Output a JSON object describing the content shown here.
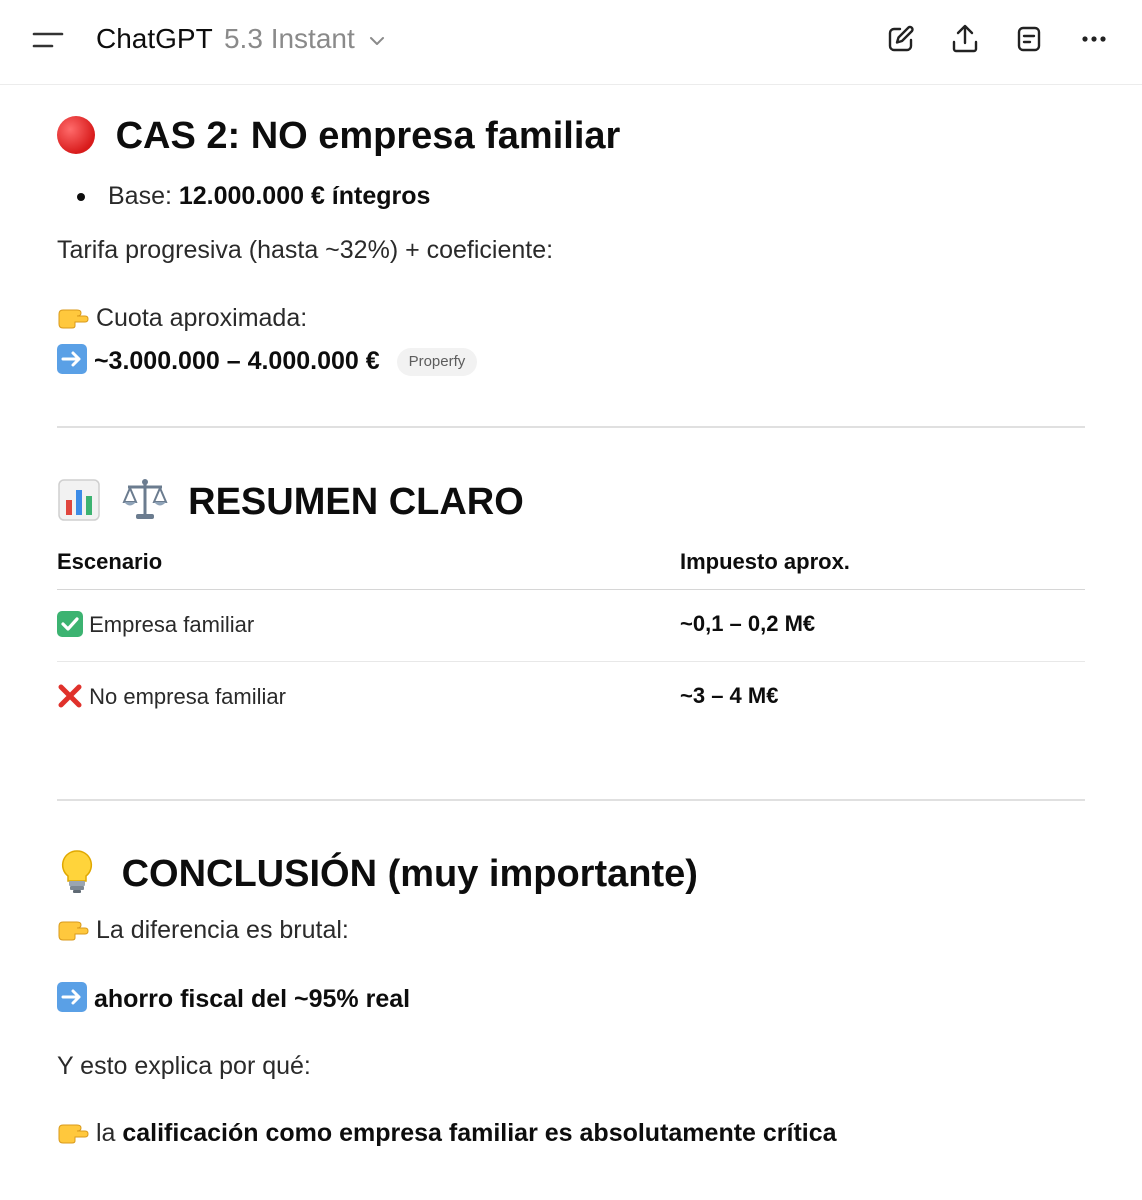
{
  "header": {
    "app_name": "ChatGPT",
    "model_name": "5.3 Instant"
  },
  "section_cas2": {
    "heading": "CAS 2: NO empresa familiar",
    "bullet_label": "Base: ",
    "bullet_value": "12.000.000 € íntegros",
    "tarifa_text": "Tarifa progresiva (hasta ~32%) + coeficiente:",
    "cuota_label": "Cuota aproximada:",
    "cuota_value": "~3.000.000 – 4.000.000 €",
    "source_chip": "Properfy"
  },
  "section_resumen": {
    "heading": "RESUMEN CLARO",
    "table": {
      "columns": [
        "Escenario",
        "Impuesto aprox."
      ],
      "rows": [
        {
          "scenario": "Empresa familiar",
          "tax": "~0,1 – 0,2 M€"
        },
        {
          "scenario": "No empresa familiar",
          "tax": "~3 – 4 M€"
        }
      ]
    }
  },
  "section_conclusion": {
    "heading": "CONCLUSIÓN (muy importante)",
    "line1": "La diferencia es brutal:",
    "line2": "ahorro fiscal del ~95% real",
    "line3": "Y esto explica por qué:",
    "line4_prefix": "la ",
    "line4_bold": "calificación como empresa familiar es absolutamente crítica"
  },
  "colors": {
    "text": "#0d0d0d",
    "muted": "#8a8a8a",
    "divider": "#e0e0e0",
    "chip_bg": "#f2f2f2"
  }
}
